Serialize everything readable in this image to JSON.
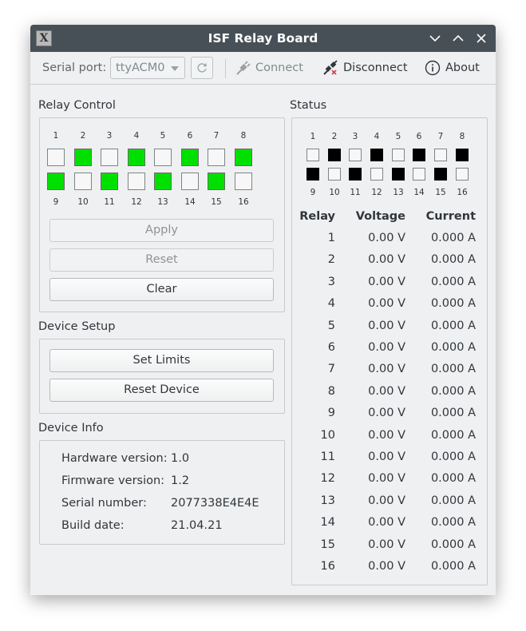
{
  "window": {
    "title": "ISF Relay Board"
  },
  "toolbar": {
    "serial_port_label": "Serial port:",
    "serial_port_value": "ttyACM0",
    "connect_label": "Connect",
    "disconnect_label": "Disconnect",
    "about_label": "About"
  },
  "relay_control": {
    "title": "Relay Control",
    "top_numbers": [
      "1",
      "2",
      "3",
      "4",
      "5",
      "6",
      "7",
      "8"
    ],
    "bottom_numbers": [
      "9",
      "10",
      "11",
      "12",
      "13",
      "14",
      "15",
      "16"
    ],
    "top_states": [
      false,
      true,
      false,
      true,
      false,
      true,
      false,
      true
    ],
    "bottom_states": [
      true,
      false,
      true,
      false,
      true,
      false,
      true,
      false
    ],
    "apply_label": "Apply",
    "reset_label": "Reset",
    "clear_label": "Clear",
    "on_color": "#00e000"
  },
  "device_setup": {
    "title": "Device Setup",
    "set_limits_label": "Set Limits",
    "reset_device_label": "Reset Device"
  },
  "device_info": {
    "title": "Device Info",
    "rows": [
      {
        "label": "Hardware version:",
        "value": "1.0"
      },
      {
        "label": "Firmware version:",
        "value": "1.2"
      },
      {
        "label": "Serial number:",
        "value": "2077338E4E4E"
      },
      {
        "label": "Build date:",
        "value": "21.04.21"
      }
    ]
  },
  "status": {
    "title": "Status",
    "top_numbers": [
      "1",
      "2",
      "3",
      "4",
      "5",
      "6",
      "7",
      "8"
    ],
    "bottom_numbers": [
      "9",
      "10",
      "11",
      "12",
      "13",
      "14",
      "15",
      "16"
    ],
    "top_states": [
      false,
      true,
      false,
      true,
      false,
      true,
      false,
      true
    ],
    "bottom_states": [
      true,
      false,
      true,
      false,
      true,
      false,
      true,
      false
    ],
    "headers": {
      "relay": "Relay",
      "voltage": "Voltage",
      "current": "Current"
    },
    "rows": [
      {
        "relay": "1",
        "voltage": "0.00 V",
        "current": "0.000 A"
      },
      {
        "relay": "2",
        "voltage": "0.00 V",
        "current": "0.000 A"
      },
      {
        "relay": "3",
        "voltage": "0.00 V",
        "current": "0.000 A"
      },
      {
        "relay": "4",
        "voltage": "0.00 V",
        "current": "0.000 A"
      },
      {
        "relay": "5",
        "voltage": "0.00 V",
        "current": "0.000 A"
      },
      {
        "relay": "6",
        "voltage": "0.00 V",
        "current": "0.000 A"
      },
      {
        "relay": "7",
        "voltage": "0.00 V",
        "current": "0.000 A"
      },
      {
        "relay": "8",
        "voltage": "0.00 V",
        "current": "0.000 A"
      },
      {
        "relay": "9",
        "voltage": "0.00 V",
        "current": "0.000 A"
      },
      {
        "relay": "10",
        "voltage": "0.00 V",
        "current": "0.000 A"
      },
      {
        "relay": "11",
        "voltage": "0.00 V",
        "current": "0.000 A"
      },
      {
        "relay": "12",
        "voltage": "0.00 V",
        "current": "0.000 A"
      },
      {
        "relay": "13",
        "voltage": "0.00 V",
        "current": "0.000 A"
      },
      {
        "relay": "14",
        "voltage": "0.00 V",
        "current": "0.000 A"
      },
      {
        "relay": "15",
        "voltage": "0.00 V",
        "current": "0.000 A"
      },
      {
        "relay": "16",
        "voltage": "0.00 V",
        "current": "0.000 A"
      }
    ]
  },
  "icons": {
    "app": "app-x-icon",
    "minimize": "chevron-down-icon",
    "maximize": "chevron-up-icon",
    "close": "close-icon",
    "refresh": "refresh-icon",
    "connect": "plug-connect-icon",
    "disconnect": "plug-disconnect-icon",
    "about": "info-icon"
  }
}
